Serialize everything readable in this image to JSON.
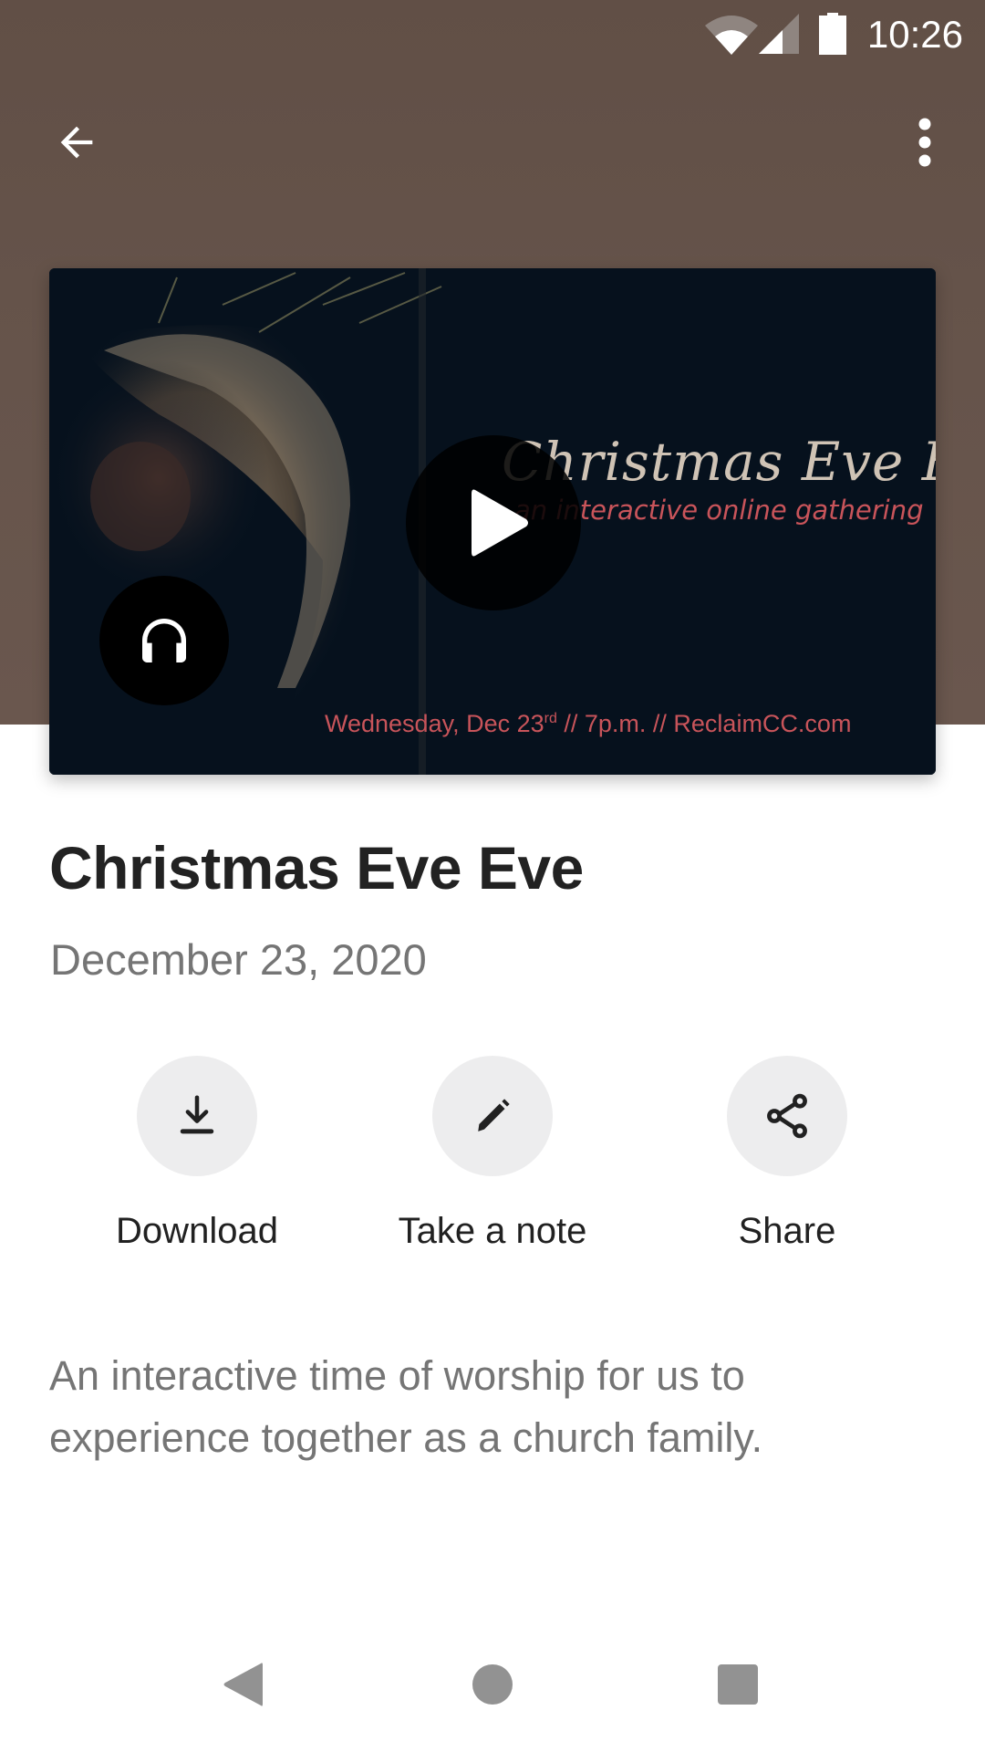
{
  "status_bar": {
    "time": "10:26",
    "icons": [
      "wifi-icon",
      "cellular-signal-icon",
      "battery-icon"
    ]
  },
  "app_bar": {
    "back_icon": "arrow-back-icon",
    "menu_icon": "more-vert-icon"
  },
  "media": {
    "artwork": {
      "title": "Christmas Eve Eve",
      "subtitle": "an interactive online gathering",
      "footer_day": "Wednesday, Dec 23",
      "footer_suffix": "rd",
      "footer_rest": " // 7p.m. // ReclaimCC.com"
    },
    "play_icon": "play-icon",
    "audio_icon": "headphones-icon"
  },
  "content": {
    "title": "Christmas Eve Eve",
    "date": "December 23, 2020",
    "actions": [
      {
        "label": "Download",
        "icon": "download-icon"
      },
      {
        "label": "Take a note",
        "icon": "pencil-icon"
      },
      {
        "label": "Share",
        "icon": "share-icon"
      }
    ],
    "description": "An interactive time of worship for us to experience together as a church family."
  },
  "nav_bar": {
    "buttons": [
      "back",
      "home",
      "recents"
    ]
  },
  "colors": {
    "header_bg": "#66544b",
    "title_text": "#222222",
    "secondary_text": "#757575",
    "action_circle": "#ededee",
    "art_accent": "#c8545a"
  }
}
